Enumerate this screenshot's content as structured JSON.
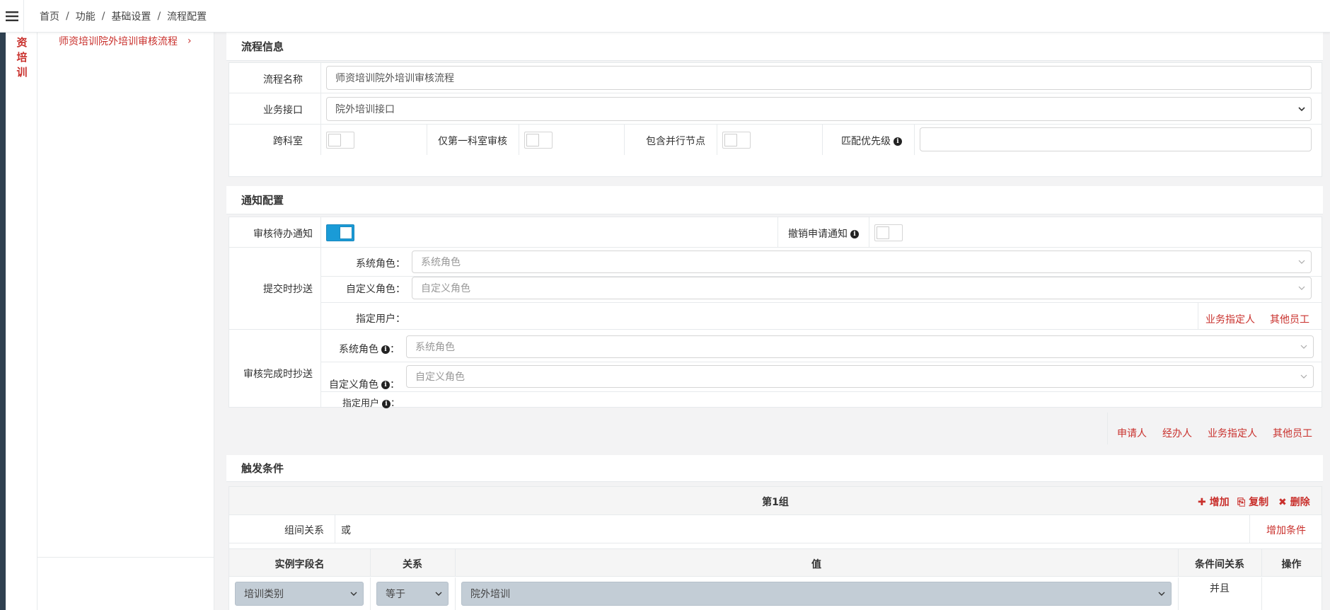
{
  "breadcrumb": [
    "首页",
    "功能",
    "基础设置",
    "流程配置"
  ],
  "vertical_nav_text": "资培训",
  "subnav": {
    "active_item": "师资培训院外培训审核流程",
    "arrow": "›"
  },
  "flow_info": {
    "title": "流程信息",
    "name_label": "流程名称",
    "name_value": "师资培训院外培训审核流程",
    "interface_label": "业务接口",
    "interface_value": "院外培训接口",
    "cross_dept_label": "跨科室",
    "first_dept_only_label": "仅第一科室审核",
    "parallel_node_label": "包含并行节点",
    "priority_label": "匹配优先级",
    "priority_value": ""
  },
  "notify": {
    "title": "通知配置",
    "todo_label": "审核待办通知",
    "todo_on": true,
    "revoke_label": "撤销申请通知",
    "revoke_on": false,
    "submit_cc": {
      "label": "提交时抄送",
      "sys_role_label": "系统角色：",
      "sys_role_placeholder": "系统角色",
      "custom_role_label": "自定义角色：",
      "custom_role_placeholder": "自定义角色",
      "user_label": "指定用户：",
      "links": [
        "业务指定人",
        "其他员工"
      ]
    },
    "done_cc": {
      "label": "审核完成时抄送",
      "sys_role_label": "系统角色",
      "sys_role_placeholder": "系统角色",
      "custom_role_label": "自定义角色",
      "custom_role_placeholder": "自定义角色",
      "user_label": "指定用户",
      "colon": "：",
      "links": [
        "申请人",
        "经办人",
        "业务指定人",
        "其他员工"
      ]
    }
  },
  "trigger": {
    "title": "触发条件",
    "group_title": "第1组",
    "add": "✚ 增加",
    "copy": "复制",
    "delete": "✖ 删除",
    "group_rel_label": "组间关系",
    "group_rel_value": "或",
    "add_condition": "增加条件",
    "columns": [
      "实例字段名",
      "关系",
      "值",
      "条件间关系",
      "操作"
    ],
    "row": {
      "field": "培训类别",
      "relation": "等于",
      "value": "院外培训",
      "cond_rel": "并且"
    }
  },
  "colors": {
    "accent_red": "#c9302c",
    "toggle_on": "#1a9bd7"
  }
}
